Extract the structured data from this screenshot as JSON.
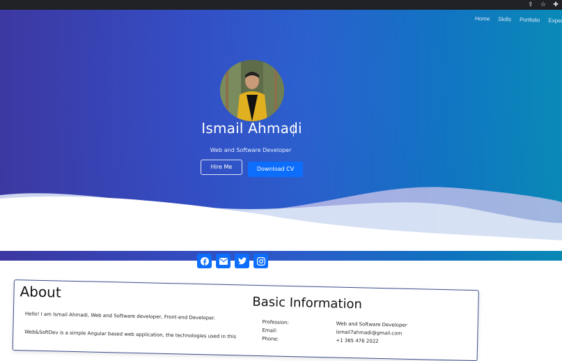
{
  "browser": {
    "icons": [
      "share-icon",
      "star-icon",
      "extensions-icon"
    ]
  },
  "nav": {
    "items": [
      "Home",
      "Skills",
      "Portfolio",
      "Experience"
    ]
  },
  "hero": {
    "name": "Ismail Ahmadi",
    "subtitle": "Web and Software Developer",
    "hire_label": "Hire Me",
    "cv_label": "Download CV",
    "gradient_start": "#3f3aa8",
    "gradient_end": "#0a8fbe",
    "accent": "#0d6efd"
  },
  "socials": [
    "facebook-icon",
    "email-icon",
    "twitter-icon",
    "instagram-icon"
  ],
  "about": {
    "title": "About",
    "text1": "Hello! I am Ismail Ahmadi, Web and Software developer, Front-end Developer.",
    "text2": "Web&SoftDev is a simple Angular based web application, the technologies used in this"
  },
  "basic_info": {
    "title": "Basic Information",
    "rows": [
      {
        "label": "Profession:",
        "value": "Web and Software Developer"
      },
      {
        "label": "Email:",
        "value": "ismail7ahmadi@gmail.com"
      },
      {
        "label": "Phone:",
        "value": "+1 365 476 2022"
      }
    ]
  }
}
